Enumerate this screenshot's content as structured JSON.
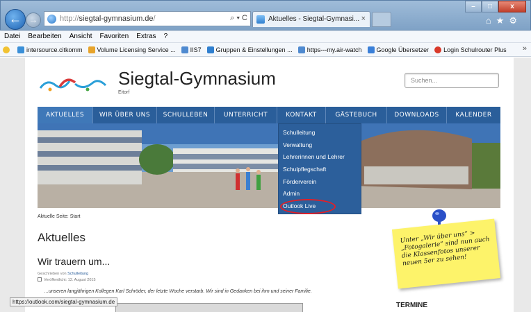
{
  "browser": {
    "address_prefix": "http://",
    "address_domain": "siegtal-gymnasium.de",
    "address_suffix": "/",
    "address_tools": "⌕ ▾ C",
    "tab_title": "Aktuelles - Siegtal-Gymnasi...",
    "tab_close": "×",
    "menu": [
      "Datei",
      "Bearbeiten",
      "Ansicht",
      "Favoriten",
      "Extras",
      "?"
    ],
    "favorites": [
      {
        "label": "intersource.citkomm",
        "color": "#3a8fd8"
      },
      {
        "label": "Volume Licensing Service ...",
        "color": "#e7a42c"
      },
      {
        "label": "IIS7",
        "color": "#4f8ad0"
      },
      {
        "label": "Gruppen & Einstellungen ...",
        "color": "#2f7fcf"
      },
      {
        "label": "https---my.air-watch",
        "color": "#4f8ad0"
      },
      {
        "label": "Google Übersetzer",
        "color": "#3a7fd8"
      },
      {
        "label": "Login Schulrouter Plus",
        "color": "#d9392a"
      }
    ],
    "fav_more": "»",
    "status_url": "https://outlook.com/siegtal-gymnasium.de",
    "window_buttons": [
      "–",
      "□",
      "x"
    ],
    "right_icons": "⌂★⚙"
  },
  "site": {
    "title": "Siegtal-Gymnasium",
    "subtitle": "Eitorf",
    "search_placeholder": "Suchen...",
    "nav": [
      "AKTUELLES",
      "WIR ÜBER UNS",
      "SCHULLEBEN",
      "UNTERRICHT",
      "KONTAKT",
      "GÄSTEBUCH",
      "DOWNLOADS",
      "KALENDER"
    ],
    "nav_active": "AKTUELLES",
    "dropdown": [
      "Schulleitung",
      "Verwaltung",
      "Lehrerinnen und Lehrer",
      "Schulpflegschaft",
      "Förderverein",
      "Admin",
      "Outlook Live"
    ],
    "current_page": "Aktuelle Seite: Start",
    "heading": "Aktuelles",
    "article_title": "Wir trauern um...",
    "meta_written_prefix": "Geschrieben von",
    "meta_written_author": "Schulleitung",
    "meta_published": "Veröffentlicht: 12. August 2015",
    "excerpt": "...unseren langjährigen Kollegen Karl Schröder, der letzte Woche verstarb. Wir sind in Gedanken bei ihm und seiner Familie.",
    "sticky_note": "Unter „Wir über uns“ > „Fotogalerie“ sind nun auch die Klassenfotos unserer neuen 5er zu sehen!",
    "sidebar_heading": "TERMINE"
  },
  "colors": {
    "nav": "#2a5e9a",
    "highlight_ring": "#e41e26",
    "sticky": "#fdf36a"
  }
}
